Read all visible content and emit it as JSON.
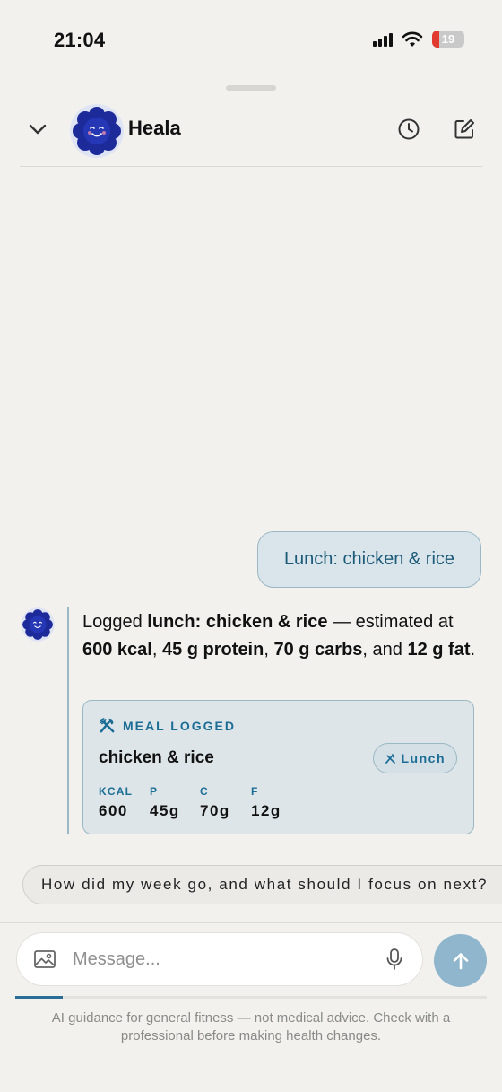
{
  "status_bar": {
    "time": "21:04",
    "battery": "19"
  },
  "header": {
    "title": "Heala"
  },
  "conversation": {
    "user_message": "Lunch: chicken & rice",
    "assistant_message": {
      "p1": "Logged ",
      "b1": "lunch: chicken & rice",
      "p2": " — estimated at ",
      "b2": "600 kcal",
      "p3": ", ",
      "b3": "45 g protein",
      "p4": ", ",
      "b4": "70 g carbs",
      "p5": ", and ",
      "b5": "12 g fat",
      "p6": "."
    },
    "meal_card": {
      "kicker": "MEAL LOGGED",
      "name": "chicken & rice",
      "tag": "Lunch",
      "macros": [
        {
          "label": "KCAL",
          "value": "600"
        },
        {
          "label": "P",
          "value": "45g"
        },
        {
          "label": "C",
          "value": "70g"
        },
        {
          "label": "F",
          "value": "12g"
        }
      ]
    }
  },
  "suggestion": "How did my week go, and what should I focus on next?",
  "composer": {
    "placeholder": "Message...",
    "progress": 0.1
  },
  "disclaimer": "AI guidance for general fitness — not medical advice. Check with a professional before making health changes.",
  "colors": {
    "accent": "#1b6d96",
    "send": "#8fb6cd",
    "bubble": "#d9e5ea"
  }
}
